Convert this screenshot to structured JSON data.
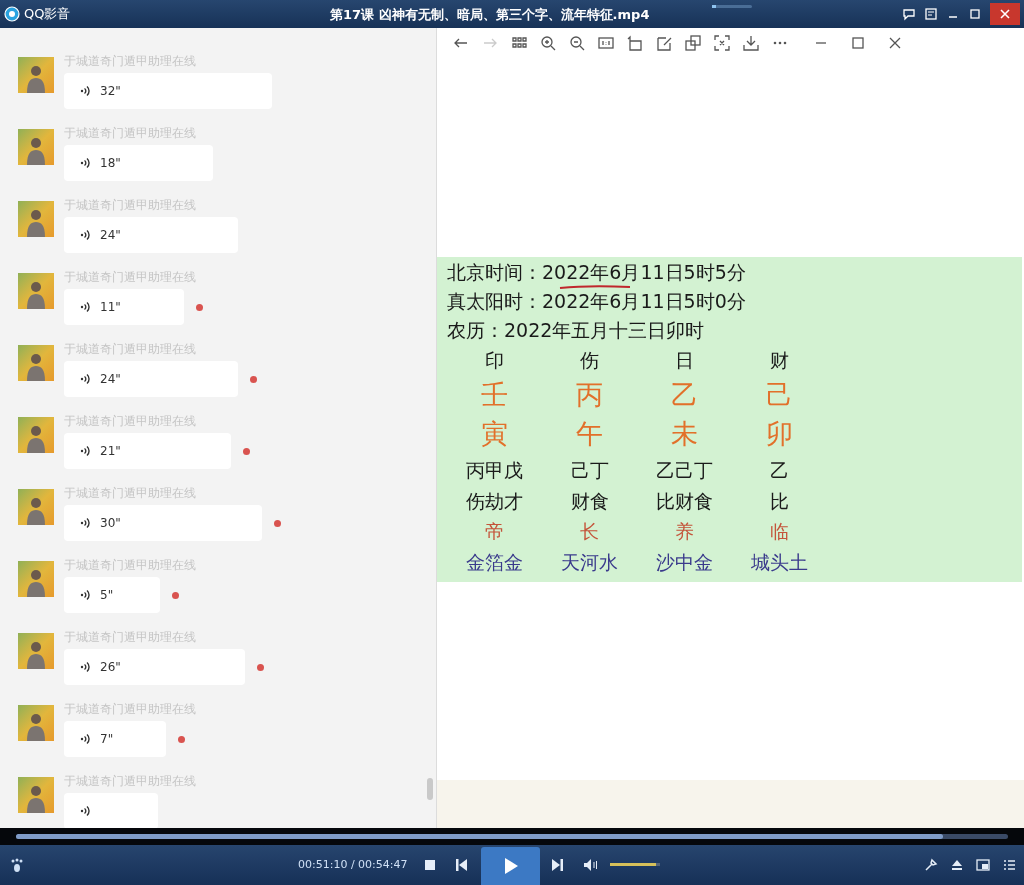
{
  "window": {
    "app_name": "QQ影音",
    "title": "第17课 凶神有无制、暗局、第三个字、流年特征.mp4"
  },
  "chat": {
    "messages": [
      {
        "sender": "于城道奇门遁甲助理在线",
        "duration": "32\"",
        "unread": false
      },
      {
        "sender": "于城道奇门遁甲助理在线",
        "duration": "18\"",
        "unread": false
      },
      {
        "sender": "于城道奇门遁甲助理在线",
        "duration": "24\"",
        "unread": false
      },
      {
        "sender": "于城道奇门遁甲助理在线",
        "duration": "11\"",
        "unread": true
      },
      {
        "sender": "于城道奇门遁甲助理在线",
        "duration": "24\"",
        "unread": true
      },
      {
        "sender": "于城道奇门遁甲助理在线",
        "duration": "21\"",
        "unread": true
      },
      {
        "sender": "于城道奇门遁甲助理在线",
        "duration": "30\"",
        "unread": true
      },
      {
        "sender": "于城道奇门遁甲助理在线",
        "duration": "5\"",
        "unread": true
      },
      {
        "sender": "于城道奇门遁甲助理在线",
        "duration": "26\"",
        "unread": true
      },
      {
        "sender": "于城道奇门遁甲助理在线",
        "duration": "7\"",
        "unread": true
      },
      {
        "sender": "于城道奇门遁甲助理在线",
        "unread": false
      }
    ]
  },
  "viewer": {
    "nav": [
      {
        "disabled": false
      },
      {
        "disabled": true
      }
    ],
    "info_lines": [
      {
        "text": "北京时间：2022年6月11日5时5分",
        "marked": true
      },
      {
        "text": "真太阳时：2022年6月11日5时0分",
        "marked": false
      },
      {
        "text": "农历：2022年五月十三日卯时",
        "marked": false
      }
    ],
    "chart_rows": [
      {
        "kind": "ten_god",
        "cells": [
          "印",
          "伤",
          "日",
          "财"
        ]
      },
      {
        "kind": "stem",
        "cells": [
          "壬",
          "丙",
          "乙",
          "己"
        ]
      },
      {
        "kind": "branch",
        "cells": [
          "寅",
          "午",
          "未",
          "卯"
        ]
      },
      {
        "kind": "hidden_stems",
        "cells": [
          "丙甲戊",
          "己丁",
          "乙己丁",
          "乙"
        ]
      },
      {
        "kind": "hidden_gods",
        "cells": [
          "伤劫才",
          "财食",
          "比财食",
          "比"
        ]
      },
      {
        "kind": "stage",
        "cells": [
          "帝",
          "长",
          "养",
          "临"
        ]
      },
      {
        "kind": "nayin",
        "cells": [
          "金箔金",
          "天河水",
          "沙中金",
          "城头土"
        ]
      }
    ]
  },
  "title_slider": {
    "level": 0.1
  },
  "player": {
    "progress": {
      "level": 0.934
    },
    "time": "00:51:10 / 00:54:47",
    "volume": {
      "level": 0.92
    }
  }
}
